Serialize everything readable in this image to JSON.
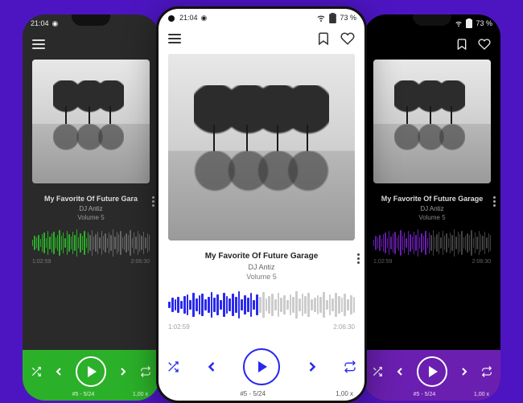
{
  "status": {
    "time": "21:04",
    "battery": "73 %"
  },
  "track": {
    "title_full": "My Favorite Of Future Garage",
    "title_trunc": "My Favorite Of Future Gara",
    "artist": "DJ Antiz",
    "volume": "Volume 5"
  },
  "time": {
    "elapsed": "1:02:59",
    "total": "2:06:30"
  },
  "footer": {
    "position": "#5  -  5/24",
    "speed": "1,00 x"
  },
  "accents": {
    "left": "#2bb029",
    "center": "#2929ef",
    "right": "#6a1fb0"
  },
  "wave": {
    "played_pct": 48,
    "bars": [
      8,
      18,
      14,
      20,
      10,
      22,
      26,
      12,
      30,
      16,
      24,
      28,
      14,
      20,
      32,
      18,
      26,
      12,
      30,
      22,
      16,
      28,
      20,
      34,
      14,
      24,
      18,
      30,
      12,
      26,
      20,
      32,
      16,
      22,
      28,
      14,
      30,
      18,
      24,
      12,
      26,
      20,
      34,
      16,
      28,
      22,
      30,
      14,
      18,
      24,
      20,
      32,
      12,
      26,
      16,
      30,
      22,
      18,
      28,
      14,
      24,
      20
    ]
  }
}
